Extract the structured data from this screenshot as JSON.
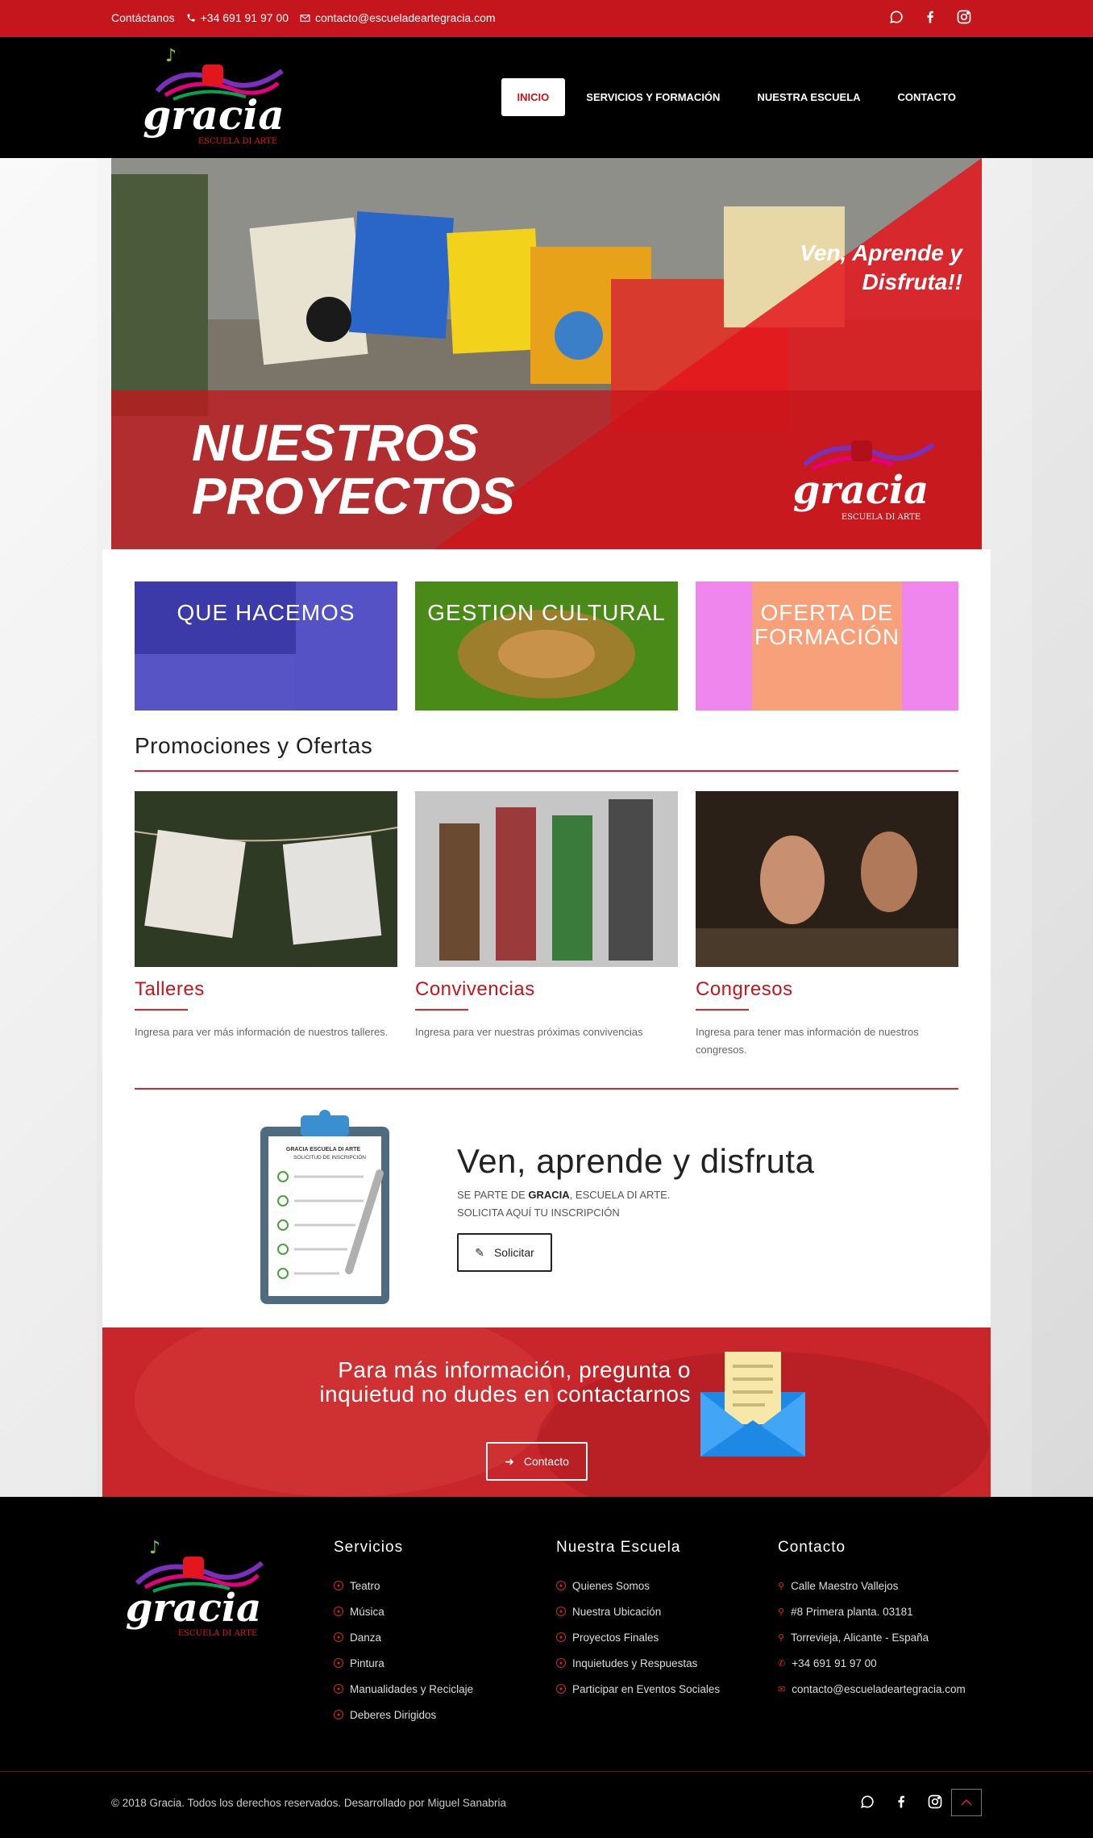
{
  "topbar": {
    "contact_label": "Contáctanos",
    "phone": "+34 691 91 97 00",
    "email": "contacto@escueladeartegracia.com"
  },
  "nav": {
    "items": [
      "INICIO",
      "SERVICIOS Y FORMACIÓN",
      "NUESTRA ESCUELA",
      "CONTACTO"
    ],
    "active": "INICIO"
  },
  "logo": {
    "word": "gracia",
    "subtitle": "ESCUELA DI ARTE"
  },
  "hero": {
    "tagline": "Ven, Aprende y Disfruta!!",
    "title_line1": "NUESTROS",
    "title_line2": "PROYECTOS",
    "logo_subtitle": "ESCUELA DI ARTE"
  },
  "features": [
    "QUE HACEMOS",
    "GESTION CULTURAL",
    "OFERTA DE FORMACIÓN"
  ],
  "promotions": {
    "title": "Promociones y Ofertas",
    "items": [
      {
        "title": "Talleres",
        "text": "Ingresa para ver más información de nuestros talleres."
      },
      {
        "title": "Convivencias",
        "text": "Ingresa para ver nuestras próximas convivencias"
      },
      {
        "title": "Congresos",
        "text": "Ingresa para tener mas información de nuestros congresos."
      }
    ]
  },
  "cta": {
    "title": "Ven, aprende y disfruta",
    "sub_prefix": "SE PARTE DE ",
    "sub_brand": "GRACIA",
    "sub_suffix": ", ESCUELA DI ARTE.",
    "sub_line2": "SOLICITA AQUÍ TU INSCRIPCIÓN",
    "button": "Solicitar",
    "clipboard_header": "GRACIA ESCUELA DI ARTE",
    "clipboard_sub": "SOLICITUD DE INSCRIPCIÓN"
  },
  "contact_band": {
    "text": "Para más información, pregunta o inquietud no dudes en contactarnos",
    "button": "Contacto"
  },
  "footer": {
    "servicios": {
      "title": "Servicios",
      "items": [
        "Teatro",
        "Música",
        "Danza",
        "Pintura",
        "Manualidades y Reciclaje",
        "Deberes Dirigidos"
      ]
    },
    "escuela": {
      "title": "Nuestra Escuela",
      "items": [
        "Quienes Somos",
        "Nuestra Ubicación",
        "Proyectos Finales",
        "Inquietudes y Respuestas",
        "Participar en Eventos Sociales"
      ]
    },
    "contacto": {
      "title": "Contacto",
      "address1": "Calle Maestro Vallejos",
      "address2": "#8 Primera planta. 03181",
      "address3": "Torrevieja, Alicante - España",
      "phone": "+34 691 91 97 00",
      "email": "contacto@escueladeartegracia.com"
    },
    "copyright": "© 2018 Gracia. Todos los derechos reservados. Desarrollado por ",
    "author": "Miguel Sanabria"
  },
  "colors": {
    "brand_red": "#c4161c",
    "black": "#000000"
  },
  "icons": [
    "whatsapp-icon",
    "facebook-icon",
    "instagram-icon",
    "phone-icon",
    "mail-icon",
    "location-icon",
    "pencil-icon",
    "arrow-right-icon",
    "chevron-up-icon"
  ]
}
